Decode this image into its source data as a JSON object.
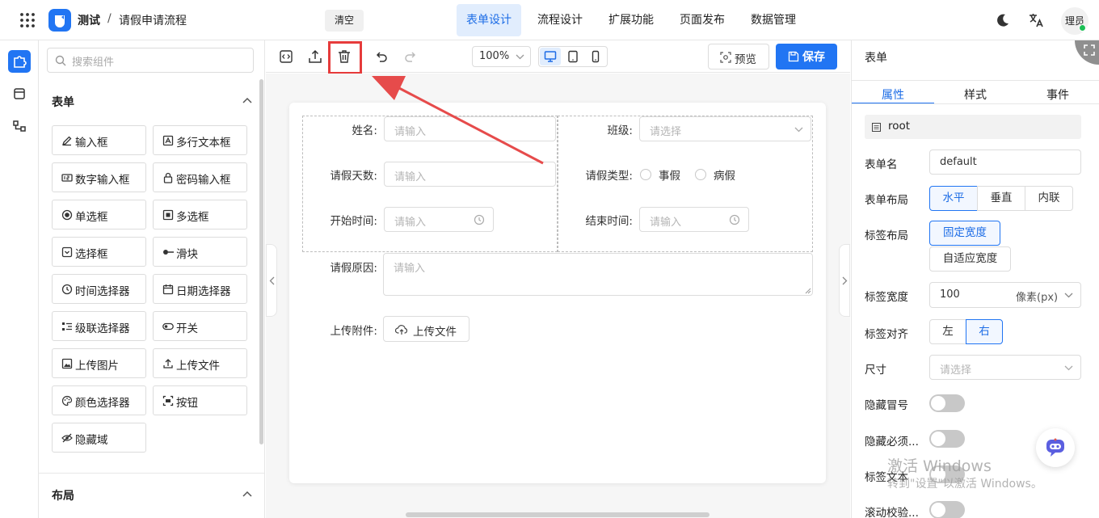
{
  "header": {
    "app_name": "测试",
    "breadcrumb_sep": "/",
    "page_title": "请假申请流程",
    "clear_label": "清空",
    "tabs": [
      {
        "label": "表单设计",
        "active": true
      },
      {
        "label": "流程设计",
        "active": false
      },
      {
        "label": "扩展功能",
        "active": false
      },
      {
        "label": "页面发布",
        "active": false
      },
      {
        "label": "数据管理",
        "active": false
      }
    ],
    "user_label": "理员",
    "accent": "#2175f3"
  },
  "sidebar": {
    "rail_icons": [
      "puzzle-icon",
      "code-box-icon",
      "flow-icon"
    ],
    "search_placeholder": "搜索组件",
    "sections": [
      {
        "title": "表单",
        "items": [
          {
            "label": "输入框",
            "icon": "pencil-icon"
          },
          {
            "label": "多行文本框",
            "icon": "textarea-icon"
          },
          {
            "label": "数字输入框",
            "icon": "number-icon"
          },
          {
            "label": "密码输入框",
            "icon": "lock-icon"
          },
          {
            "label": "单选框",
            "icon": "radio-icon"
          },
          {
            "label": "多选框",
            "icon": "checkbox-icon"
          },
          {
            "label": "选择框",
            "icon": "select-icon"
          },
          {
            "label": "滑块",
            "icon": "slider-icon"
          },
          {
            "label": "时间选择器",
            "icon": "clock-icon"
          },
          {
            "label": "日期选择器",
            "icon": "calendar-icon"
          },
          {
            "label": "级联选择器",
            "icon": "cascader-icon"
          },
          {
            "label": "开关",
            "icon": "switch-icon"
          },
          {
            "label": "上传图片",
            "icon": "image-icon"
          },
          {
            "label": "上传文件",
            "icon": "upload-icon"
          },
          {
            "label": "颜色选择器",
            "icon": "palette-icon"
          },
          {
            "label": "按钮",
            "icon": "button-icon"
          },
          {
            "label": "隐藏域",
            "icon": "eye-off-icon"
          }
        ]
      },
      {
        "title": "布局",
        "items": []
      }
    ]
  },
  "toolbar": {
    "zoom": "100%",
    "preview_label": "预览",
    "save_label": "保存",
    "devices": [
      "desktop-icon",
      "tablet-icon",
      "mobile-icon"
    ],
    "highlighted_tool": "trash-icon"
  },
  "form": {
    "fields": {
      "name": {
        "label": "姓名:",
        "placeholder": "请输入"
      },
      "class": {
        "label": "班级:",
        "placeholder": "请选择"
      },
      "days": {
        "label": "请假天数:",
        "placeholder": "请输入"
      },
      "leave_type": {
        "label": "请假类型:",
        "options": [
          "事假",
          "病假"
        ]
      },
      "start": {
        "label": "开始时间:",
        "placeholder": "请输入"
      },
      "end": {
        "label": "结束时间:",
        "placeholder": "请输入"
      },
      "reason": {
        "label": "请假原因:",
        "placeholder": "请输入"
      },
      "attachment": {
        "label": "上传附件:",
        "button": "上传文件"
      }
    }
  },
  "props": {
    "title": "表单",
    "tabs": [
      {
        "label": "属性",
        "active": true
      },
      {
        "label": "样式",
        "active": false
      },
      {
        "label": "事件",
        "active": false
      }
    ],
    "root_label": "root",
    "form_name_label": "表单名",
    "form_name_value": "default",
    "layout_label": "表单布局",
    "layout_options": [
      {
        "label": "水平",
        "active": true
      },
      {
        "label": "垂直",
        "active": false
      },
      {
        "label": "内联",
        "active": false
      }
    ],
    "label_layout_label": "标签布局",
    "label_layout_options": [
      {
        "label": "固定宽度",
        "active": true
      },
      {
        "label": "自适应宽度",
        "active": false
      }
    ],
    "label_width_label": "标签宽度",
    "label_width_value": "100",
    "label_width_unit": "像素(px)",
    "label_align_label": "标签对齐",
    "label_align_options": [
      {
        "label": "左",
        "active": false
      },
      {
        "label": "右",
        "active": true
      }
    ],
    "size_label": "尺寸",
    "size_placeholder": "请选择",
    "hide_colon_label": "隐藏冒号",
    "hide_required_label": "隐藏必须...",
    "label_text_label": "标签文本",
    "scroll_validate_label": "滚动校验..."
  },
  "watermark": {
    "line1": "激活 Windows",
    "line2": "转到\"设置\"以激活 Windows。"
  }
}
